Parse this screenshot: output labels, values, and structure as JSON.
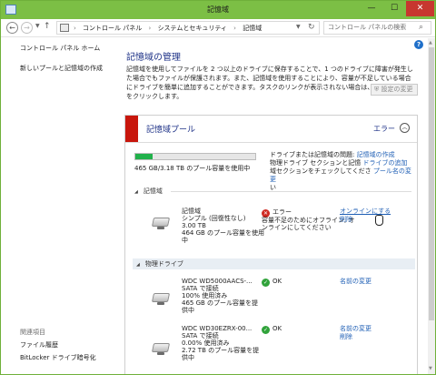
{
  "window": {
    "title": "記憶域",
    "minimize": "—",
    "maximize": "☐",
    "close": "✕"
  },
  "address_bar": {
    "breadcrumbs": [
      "コントロール パネル",
      "システムとセキュリティ",
      "記憶域"
    ],
    "separator": "›",
    "search_placeholder": "コントロール パネルの検索"
  },
  "sidebar": {
    "home": "コントロール パネル ホーム",
    "create_pool": "新しいプールと記憶域の作成",
    "related_title": "関連項目",
    "related": [
      "ファイル履歴",
      "BitLocker ドライブ暗号化"
    ]
  },
  "main": {
    "heading": "記憶域の管理",
    "intro": "記憶域を使用してファイルを 2 つ以上のドライブに保存することで、1 つのドライブに障害が発生した場合でもファイルが保護されます。また、記憶域を使用することにより、容量が不足している場合にドライブを簡単に追加することができます。タスクのリンクが表示されない場合は、[設定の変更] をクリックします。",
    "settings_button": "設定の変更"
  },
  "pool": {
    "title": "記憶域プール",
    "status": "エラー",
    "usage_fraction": 0.146,
    "usage_text": "465 GB/3.18 TB のプール容量を使用中",
    "message_prefix": "ドライブまたは記憶域の問題: ",
    "message_link": "記憶域の作成",
    "message_line2_pre": "物理ドライブ",
    "message_line2_mid": " セクションと記憶",
    "message_line2_link": "ドライブの追加",
    "message_line3_pre": "域セクションをチェックしてくださ",
    "message_line3_link": "プール名の変更",
    "message_line4": "い"
  },
  "spaces_section": {
    "title": "記憶域",
    "item": {
      "name": "記憶域",
      "type": "シンプル (回復性なし)",
      "size": "3.00 TB",
      "usage": "464 GB のプール容量を使用",
      "usage2": "中",
      "status": "エラー",
      "detail1": "容量不足のためにオフライン; オ",
      "detail2": "ンラインにしてください",
      "action1": "オンラインにする",
      "action2": "削除"
    }
  },
  "physical_section": {
    "title": "物理ドライブ",
    "drives": [
      {
        "name": "WDC WD5000AACS-...",
        "connection": "SATA で接続",
        "usage_pct": "100% 使用済み",
        "capacity": "465 GB のプール容量を提",
        "capacity2": "供中",
        "status": "OK",
        "action1": "名前の変更"
      },
      {
        "name": "WDC WD30EZRX-00...",
        "connection": "SATA で接続",
        "usage_pct": "0.00% 使用済み",
        "capacity": "2.72 TB のプール容量を提",
        "capacity2": "供中",
        "status": "OK",
        "action1": "名前の変更",
        "action2": "削除"
      }
    ]
  },
  "colors": {
    "titlebar": "#7cbf45",
    "link": "#1f5fb5",
    "heading": "#1e3287",
    "error_bar": "#c8160c",
    "usage_fill": "#21b14b"
  }
}
